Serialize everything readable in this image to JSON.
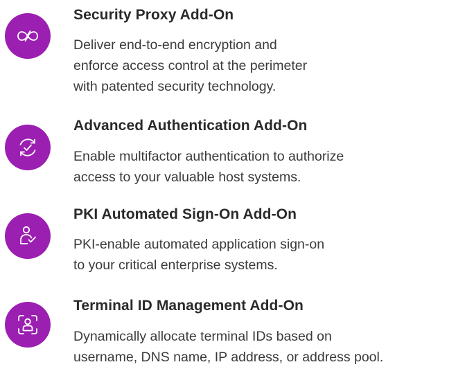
{
  "features": [
    {
      "icon": "infinity-link-icon",
      "title": "Security Proxy Add-On",
      "description_lines": [
        "Deliver end-to-end encryption and",
        "enforce access control at the perimeter",
        "with patented security technology."
      ]
    },
    {
      "icon": "refresh-check-icon",
      "title": "Advanced Authentication Add-On",
      "description_lines": [
        "Enable multifactor authentication to authorize",
        "access to your valuable host systems."
      ]
    },
    {
      "icon": "user-check-icon",
      "title": "PKI Automated Sign-On Add-On",
      "description_lines": [
        "PKI-enable automated application sign-on",
        "to your critical enterprise systems."
      ]
    },
    {
      "icon": "face-id-icon",
      "title": "Terminal ID Management Add-On",
      "description_lines": [
        "Dynamically allocate terminal IDs based on",
        "username, DNS name, IP address, or address pool."
      ]
    }
  ],
  "colors": {
    "accent": "#9b1fb1",
    "title_text": "#2a2a2a",
    "body_text": "#3a3a3a"
  }
}
